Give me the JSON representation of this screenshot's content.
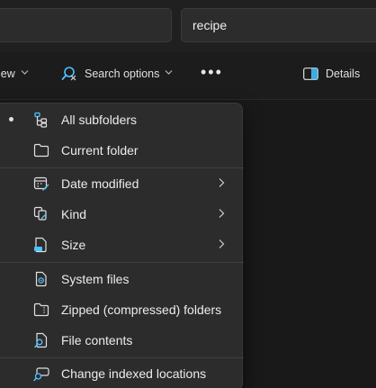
{
  "search": {
    "value": "recipe"
  },
  "toolbar": {
    "view_label": "iew",
    "search_options_label": "Search options",
    "more_label": "•••",
    "details_label": "Details"
  },
  "menu": {
    "items": [
      {
        "label": "All subfolders",
        "icon": "subfolders-icon",
        "selected": true
      },
      {
        "label": "Current folder",
        "icon": "folder-icon"
      },
      {
        "label": "Date modified",
        "icon": "calendar-edit-icon",
        "submenu": true
      },
      {
        "label": "Kind",
        "icon": "kind-icon",
        "submenu": true
      },
      {
        "label": "Size",
        "icon": "file-size-icon",
        "submenu": true
      },
      {
        "label": "System files",
        "icon": "system-file-icon"
      },
      {
        "label": "Zipped (compressed) folders",
        "icon": "zipped-folder-icon"
      },
      {
        "label": "File contents",
        "icon": "file-search-icon"
      },
      {
        "label": "Change indexed locations",
        "icon": "indexed-locations-icon"
      }
    ]
  },
  "colors": {
    "accent": "#4cc2ff",
    "menu_bg": "#2c2c2c"
  }
}
